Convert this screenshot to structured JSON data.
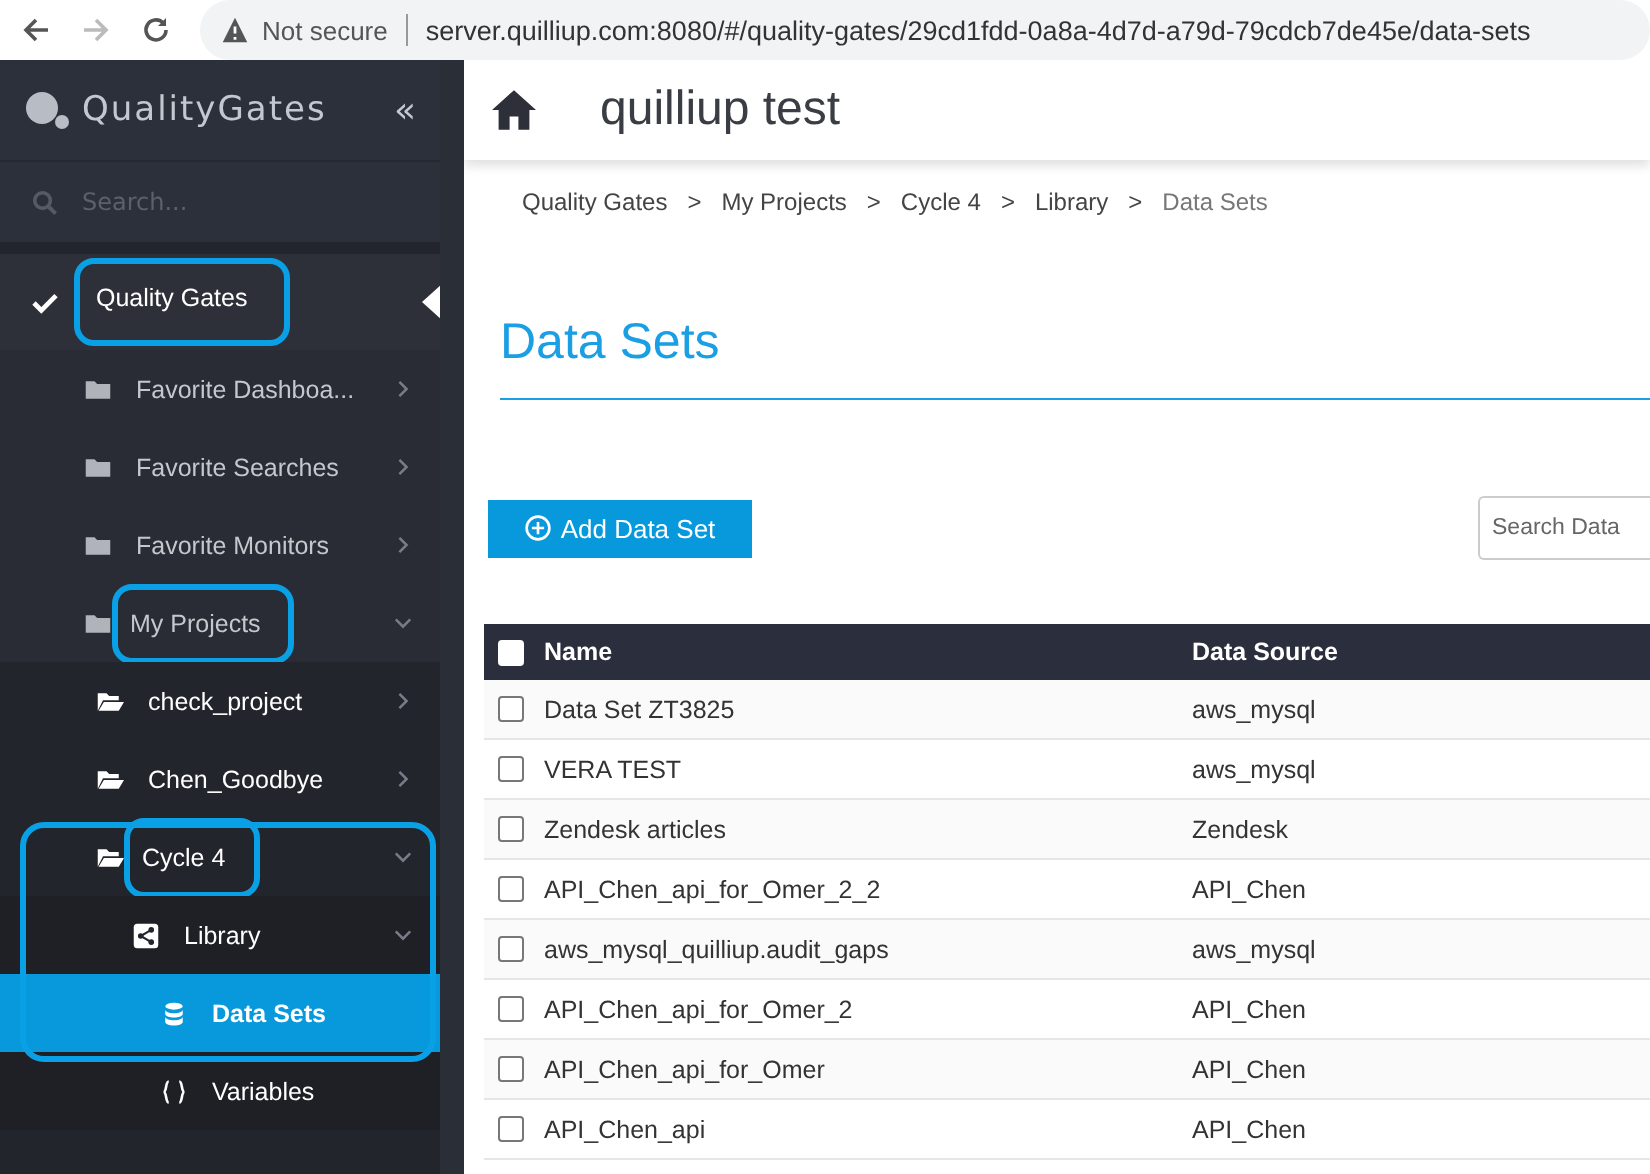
{
  "browser": {
    "security": "Not secure",
    "url": "server.quilliup.com:8080/#/quality-gates/29cd1fdd-0a8a-4d7d-a79d-79cdcb7de45e/data-sets"
  },
  "sidebar": {
    "logo": "QualityGates",
    "collapse": "«",
    "search": {
      "placeholder": "Search..."
    },
    "items": [
      {
        "label": "Quality Gates",
        "kind": "root",
        "selected": false,
        "circled": true,
        "children": [
          {
            "label": "Favorite Dashboa...",
            "kind": "folder",
            "selected": false,
            "expanded": false,
            "circled": false
          },
          {
            "label": "Favorite Searches",
            "kind": "folder",
            "selected": false,
            "expanded": false,
            "circled": false
          },
          {
            "label": "Favorite Monitors",
            "kind": "folder",
            "selected": false,
            "expanded": false,
            "circled": false
          },
          {
            "label": "My Projects",
            "kind": "folder",
            "selected": false,
            "expanded": true,
            "circled": true,
            "children": [
              {
                "label": "check_project",
                "kind": "project",
                "selected": false,
                "expanded": false,
                "circled": false
              },
              {
                "label": "Chen_Goodbye",
                "kind": "project",
                "selected": false,
                "expanded": false,
                "circled": false
              },
              {
                "label": "Cycle 4",
                "kind": "project",
                "selected": false,
                "expanded": true,
                "circled": true,
                "children": [
                  {
                    "label": "Library",
                    "kind": "library",
                    "selected": false,
                    "expanded": true,
                    "circled": false,
                    "children": [
                      {
                        "label": "Data Sets",
                        "kind": "datasets",
                        "selected": true,
                        "circled": false
                      },
                      {
                        "label": "Variables",
                        "kind": "variables",
                        "selected": false,
                        "circled": false
                      }
                    ]
                  }
                ]
              }
            ]
          }
        ]
      }
    ]
  },
  "header": {
    "title": "quilliup test"
  },
  "breadcrumb": [
    {
      "label": "Quality Gates",
      "separator": ">"
    },
    {
      "label": "My Projects",
      "separator": ">"
    },
    {
      "label": "Cycle 4",
      "separator": ">"
    },
    {
      "label": "Library",
      "separator": ">"
    },
    {
      "label": "Data Sets"
    }
  ],
  "page_title": "Data Sets",
  "add_button": "Add Data Set",
  "search": {
    "placeholder": "Search Data"
  },
  "table": {
    "select_all": {
      "checked": false
    },
    "columns": [
      "Name",
      "Data Source"
    ],
    "rows": [
      {
        "checked": false,
        "cells": [
          "Data Set ZT3825",
          "aws_mysql"
        ]
      },
      {
        "checked": false,
        "cells": [
          "VERA TEST",
          "aws_mysql"
        ]
      },
      {
        "checked": false,
        "cells": [
          "Zendesk articles",
          "Zendesk"
        ]
      },
      {
        "checked": false,
        "cells": [
          "API_Chen_api_for_Omer_2_2",
          "API_Chen"
        ]
      },
      {
        "checked": false,
        "cells": [
          "aws_mysql_quilliup.audit_gaps",
          "aws_mysql"
        ]
      },
      {
        "checked": false,
        "cells": [
          "API_Chen_api_for_Omer_2",
          "API_Chen"
        ]
      },
      {
        "checked": false,
        "cells": [
          "API_Chen_api_for_Omer",
          "API_Chen"
        ]
      },
      {
        "checked": false,
        "cells": [
          "API_Chen_api",
          "API_Chen"
        ]
      }
    ]
  }
}
